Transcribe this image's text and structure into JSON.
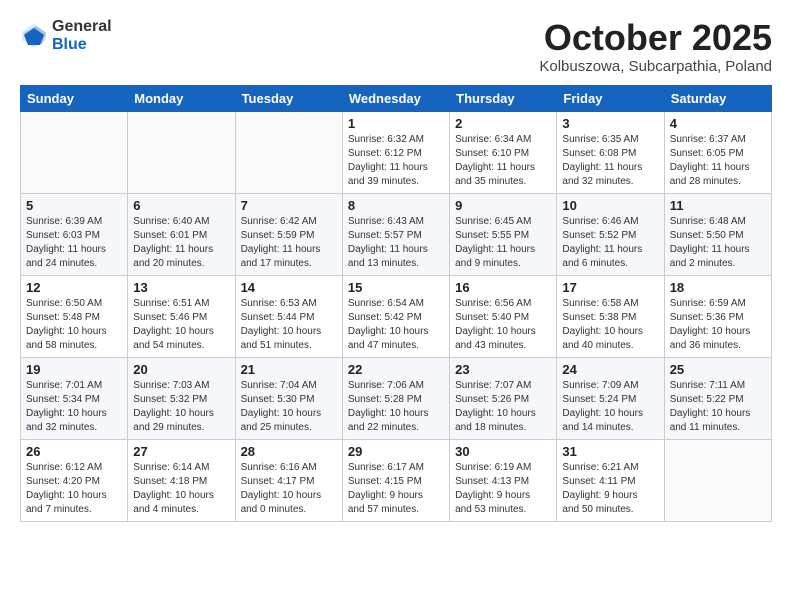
{
  "logo": {
    "general": "General",
    "blue": "Blue"
  },
  "header": {
    "title": "October 2025",
    "subtitle": "Kolbuszowa, Subcarpathia, Poland"
  },
  "weekdays": [
    "Sunday",
    "Monday",
    "Tuesday",
    "Wednesday",
    "Thursday",
    "Friday",
    "Saturday"
  ],
  "weeks": [
    [
      {
        "day": "",
        "info": ""
      },
      {
        "day": "",
        "info": ""
      },
      {
        "day": "",
        "info": ""
      },
      {
        "day": "1",
        "info": "Sunrise: 6:32 AM\nSunset: 6:12 PM\nDaylight: 11 hours\nand 39 minutes."
      },
      {
        "day": "2",
        "info": "Sunrise: 6:34 AM\nSunset: 6:10 PM\nDaylight: 11 hours\nand 35 minutes."
      },
      {
        "day": "3",
        "info": "Sunrise: 6:35 AM\nSunset: 6:08 PM\nDaylight: 11 hours\nand 32 minutes."
      },
      {
        "day": "4",
        "info": "Sunrise: 6:37 AM\nSunset: 6:05 PM\nDaylight: 11 hours\nand 28 minutes."
      }
    ],
    [
      {
        "day": "5",
        "info": "Sunrise: 6:39 AM\nSunset: 6:03 PM\nDaylight: 11 hours\nand 24 minutes."
      },
      {
        "day": "6",
        "info": "Sunrise: 6:40 AM\nSunset: 6:01 PM\nDaylight: 11 hours\nand 20 minutes."
      },
      {
        "day": "7",
        "info": "Sunrise: 6:42 AM\nSunset: 5:59 PM\nDaylight: 11 hours\nand 17 minutes."
      },
      {
        "day": "8",
        "info": "Sunrise: 6:43 AM\nSunset: 5:57 PM\nDaylight: 11 hours\nand 13 minutes."
      },
      {
        "day": "9",
        "info": "Sunrise: 6:45 AM\nSunset: 5:55 PM\nDaylight: 11 hours\nand 9 minutes."
      },
      {
        "day": "10",
        "info": "Sunrise: 6:46 AM\nSunset: 5:52 PM\nDaylight: 11 hours\nand 6 minutes."
      },
      {
        "day": "11",
        "info": "Sunrise: 6:48 AM\nSunset: 5:50 PM\nDaylight: 11 hours\nand 2 minutes."
      }
    ],
    [
      {
        "day": "12",
        "info": "Sunrise: 6:50 AM\nSunset: 5:48 PM\nDaylight: 10 hours\nand 58 minutes."
      },
      {
        "day": "13",
        "info": "Sunrise: 6:51 AM\nSunset: 5:46 PM\nDaylight: 10 hours\nand 54 minutes."
      },
      {
        "day": "14",
        "info": "Sunrise: 6:53 AM\nSunset: 5:44 PM\nDaylight: 10 hours\nand 51 minutes."
      },
      {
        "day": "15",
        "info": "Sunrise: 6:54 AM\nSunset: 5:42 PM\nDaylight: 10 hours\nand 47 minutes."
      },
      {
        "day": "16",
        "info": "Sunrise: 6:56 AM\nSunset: 5:40 PM\nDaylight: 10 hours\nand 43 minutes."
      },
      {
        "day": "17",
        "info": "Sunrise: 6:58 AM\nSunset: 5:38 PM\nDaylight: 10 hours\nand 40 minutes."
      },
      {
        "day": "18",
        "info": "Sunrise: 6:59 AM\nSunset: 5:36 PM\nDaylight: 10 hours\nand 36 minutes."
      }
    ],
    [
      {
        "day": "19",
        "info": "Sunrise: 7:01 AM\nSunset: 5:34 PM\nDaylight: 10 hours\nand 32 minutes."
      },
      {
        "day": "20",
        "info": "Sunrise: 7:03 AM\nSunset: 5:32 PM\nDaylight: 10 hours\nand 29 minutes."
      },
      {
        "day": "21",
        "info": "Sunrise: 7:04 AM\nSunset: 5:30 PM\nDaylight: 10 hours\nand 25 minutes."
      },
      {
        "day": "22",
        "info": "Sunrise: 7:06 AM\nSunset: 5:28 PM\nDaylight: 10 hours\nand 22 minutes."
      },
      {
        "day": "23",
        "info": "Sunrise: 7:07 AM\nSunset: 5:26 PM\nDaylight: 10 hours\nand 18 minutes."
      },
      {
        "day": "24",
        "info": "Sunrise: 7:09 AM\nSunset: 5:24 PM\nDaylight: 10 hours\nand 14 minutes."
      },
      {
        "day": "25",
        "info": "Sunrise: 7:11 AM\nSunset: 5:22 PM\nDaylight: 10 hours\nand 11 minutes."
      }
    ],
    [
      {
        "day": "26",
        "info": "Sunrise: 6:12 AM\nSunset: 4:20 PM\nDaylight: 10 hours\nand 7 minutes."
      },
      {
        "day": "27",
        "info": "Sunrise: 6:14 AM\nSunset: 4:18 PM\nDaylight: 10 hours\nand 4 minutes."
      },
      {
        "day": "28",
        "info": "Sunrise: 6:16 AM\nSunset: 4:17 PM\nDaylight: 10 hours\nand 0 minutes."
      },
      {
        "day": "29",
        "info": "Sunrise: 6:17 AM\nSunset: 4:15 PM\nDaylight: 9 hours\nand 57 minutes."
      },
      {
        "day": "30",
        "info": "Sunrise: 6:19 AM\nSunset: 4:13 PM\nDaylight: 9 hours\nand 53 minutes."
      },
      {
        "day": "31",
        "info": "Sunrise: 6:21 AM\nSunset: 4:11 PM\nDaylight: 9 hours\nand 50 minutes."
      },
      {
        "day": "",
        "info": ""
      }
    ]
  ]
}
